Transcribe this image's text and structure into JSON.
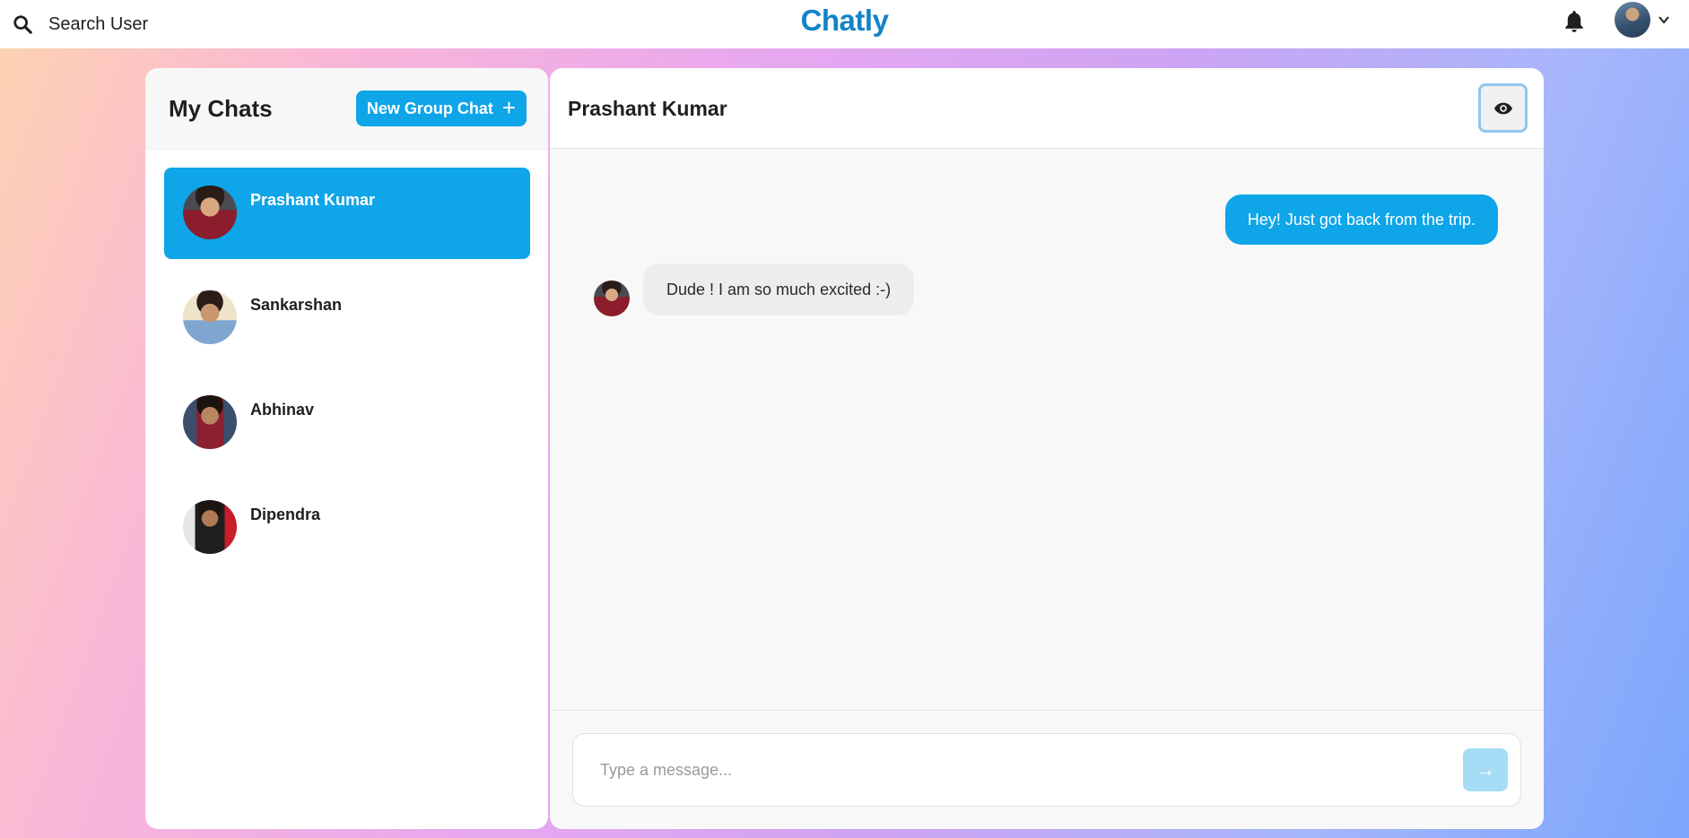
{
  "topbar": {
    "search_label": "Search User",
    "brand": "Chatly"
  },
  "sidebar": {
    "title": "My Chats",
    "new_group_label": "New Group Chat",
    "chats": [
      {
        "name": "Prashant Kumar",
        "active": true
      },
      {
        "name": "Sankarshan",
        "active": false
      },
      {
        "name": "Abhinav",
        "active": false
      },
      {
        "name": "Dipendra",
        "active": false
      }
    ]
  },
  "chat": {
    "title": "Prashant Kumar",
    "messages": [
      {
        "direction": "outgoing",
        "text": "Hey! Just got back from the trip."
      },
      {
        "direction": "incoming",
        "text": "Dude ! I am so much excited :-)"
      }
    ],
    "composer_placeholder": "Type a message...",
    "send_symbol": "→"
  },
  "icons": {
    "search": "search-icon",
    "bell": "bell-icon",
    "chevron": "chevron-down-icon",
    "eye": "eye-icon",
    "plus": "plus-icon",
    "send": "arrow-right-icon"
  },
  "colors": {
    "accent": "#0ea5e9",
    "brand": "#1183c8",
    "send_disabled": "#a5dcf6",
    "incoming_bubble": "#ededed"
  }
}
